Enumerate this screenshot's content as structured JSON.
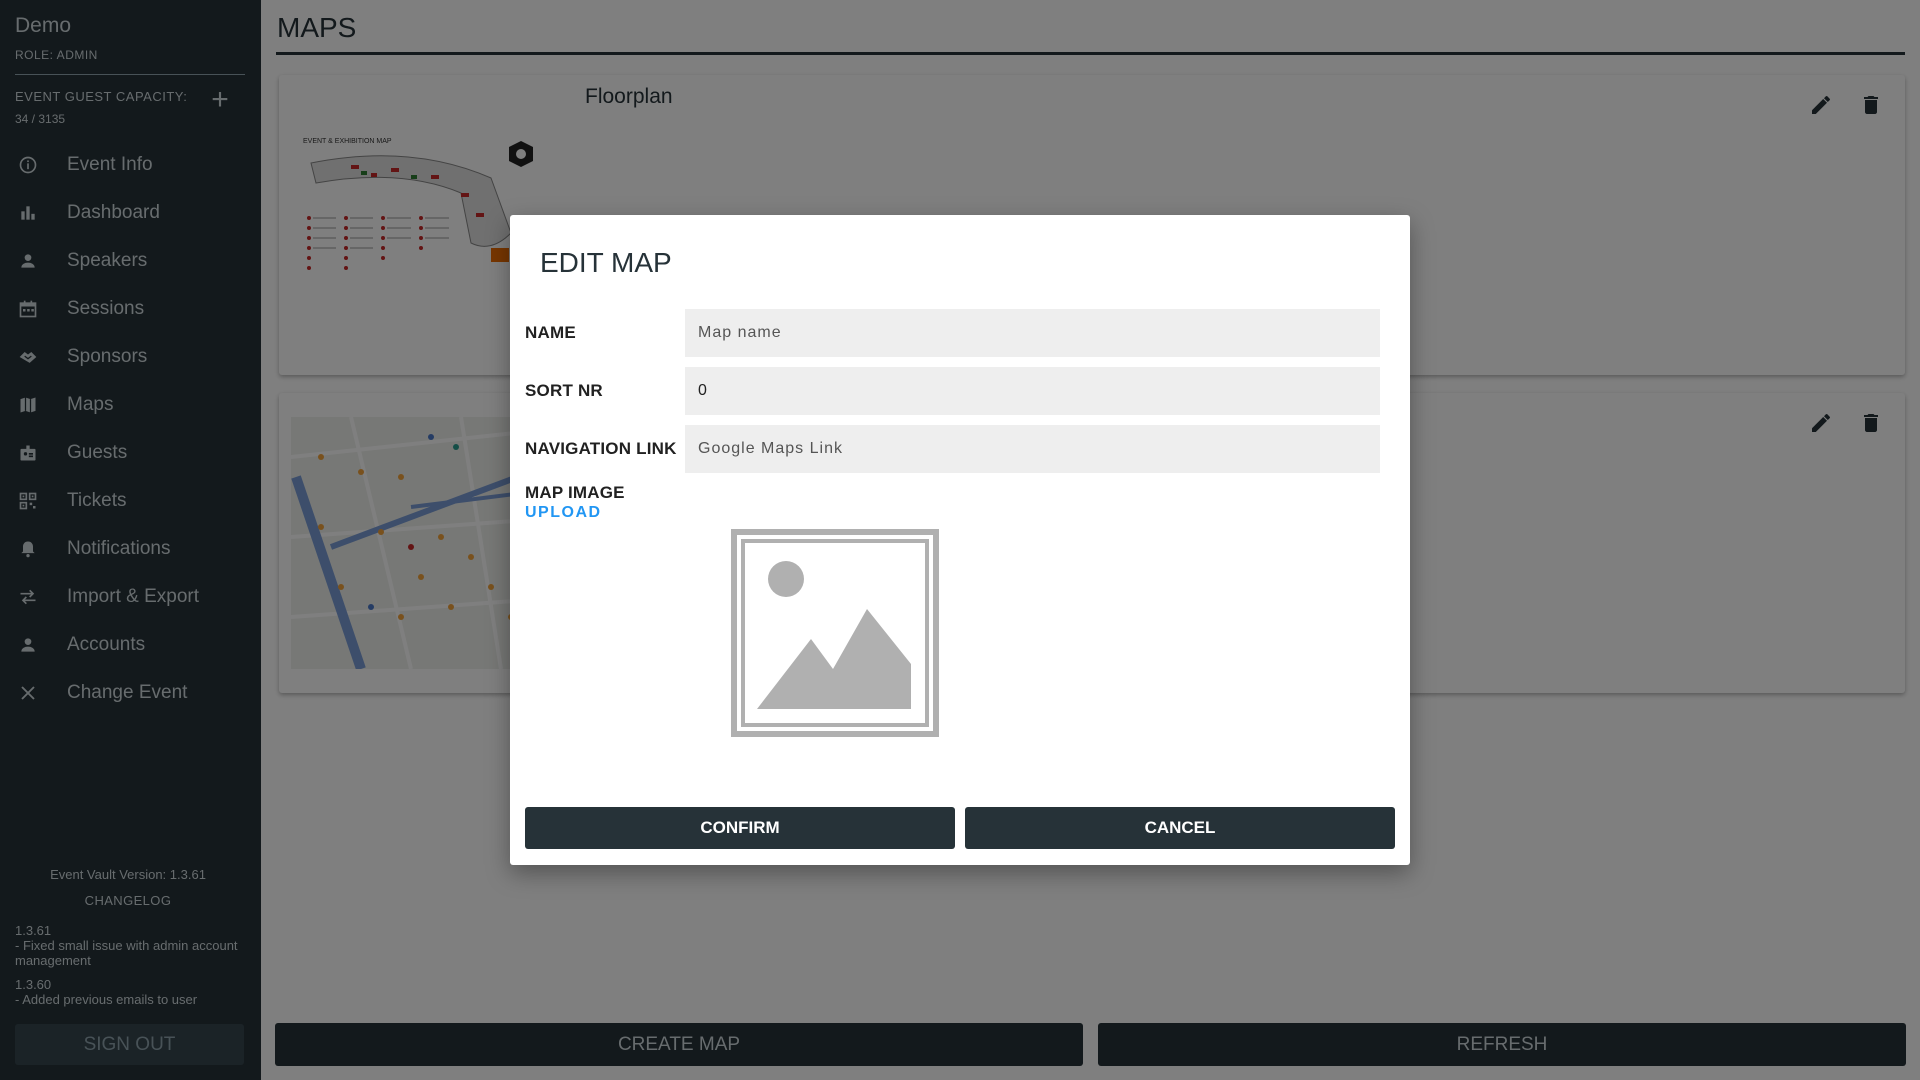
{
  "sidebar": {
    "title": "Demo",
    "role": "ROLE: ADMIN",
    "capacity_label": "EVENT GUEST CAPACITY:",
    "capacity_value": "34 / 3135",
    "items": [
      {
        "label": "Event Info",
        "icon": "info-icon"
      },
      {
        "label": "Dashboard",
        "icon": "bar-chart-icon"
      },
      {
        "label": "Speakers",
        "icon": "person-icon"
      },
      {
        "label": "Sessions",
        "icon": "calendar-icon"
      },
      {
        "label": "Sponsors",
        "icon": "handshake-icon"
      },
      {
        "label": "Maps",
        "icon": "map-icon"
      },
      {
        "label": "Guests",
        "icon": "badge-icon"
      },
      {
        "label": "Tickets",
        "icon": "qr-code-icon"
      },
      {
        "label": "Notifications",
        "icon": "bell-icon"
      },
      {
        "label": "Import & Export",
        "icon": "swap-icon"
      },
      {
        "label": "Accounts",
        "icon": "person-icon"
      },
      {
        "label": "Change Event",
        "icon": "close-icon"
      }
    ],
    "version": "Event Vault Version: 1.3.61",
    "changelog_label": "CHANGELOG",
    "changelog": [
      {
        "version": "1.3.61",
        "note": "- Fixed small issue with admin account management"
      },
      {
        "version": "1.3.60",
        "note": "- Added previous emails to user"
      }
    ],
    "signout_label": "SIGN OUT"
  },
  "main": {
    "title": "MAPS",
    "maps": [
      {
        "name": "Floorplan"
      },
      {
        "name": ""
      }
    ],
    "create_label": "CREATE MAP",
    "refresh_label": "REFRESH"
  },
  "modal": {
    "title": "EDIT MAP",
    "name_label": "NAME",
    "name_placeholder": "Map name",
    "sort_label": "SORT NR",
    "sort_value": "0",
    "nav_label": "NAVIGATION LINK",
    "nav_placeholder": "Google Maps Link",
    "image_label": "MAP IMAGE",
    "upload_label": "UPLOAD",
    "confirm_label": "CONFIRM",
    "cancel_label": "CANCEL"
  },
  "colors": {
    "sidebar_bg": "#263238",
    "accent_link": "#2196f3",
    "button_bg": "#263238"
  }
}
